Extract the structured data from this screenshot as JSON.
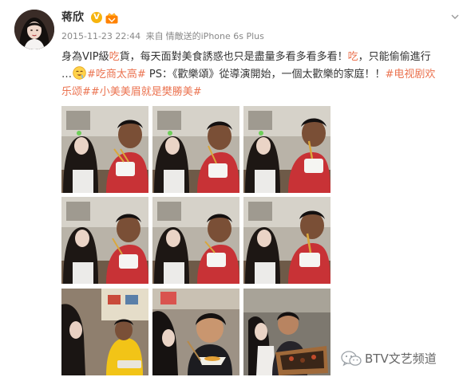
{
  "post": {
    "author": "蒋欣",
    "timestamp": "2015-11-23 22:44",
    "source_prefix": "来自",
    "source": "情敵送的iPhone 6s Plus",
    "line1": {
      "a": "身為VIP級",
      "b": "吃",
      "c": "貨，每天面對美食誘惑也只是盡量多看多看多看！",
      "d": "吃",
      "e": "，只能偷偷進行"
    },
    "line2": {
      "a": "…",
      "emoji": "drooling-face",
      "b": "#吃商太高#",
      "c": " PS：《歡樂頌》從導演開始，一個太歡樂的家庭！！",
      "d": "#电视剧欢"
    },
    "line3": {
      "a": "乐颂##小美美眉就是樊勝美#"
    }
  },
  "photos": [
    {
      "id": "photo-1",
      "scene": "eating-noodles"
    },
    {
      "id": "photo-2",
      "scene": "eating-noodles"
    },
    {
      "id": "photo-3",
      "scene": "eating-noodles"
    },
    {
      "id": "photo-4",
      "scene": "eating-noodles"
    },
    {
      "id": "photo-5",
      "scene": "eating-noodles"
    },
    {
      "id": "photo-6",
      "scene": "eating-noodles"
    },
    {
      "id": "photo-7",
      "scene": "restaurant"
    },
    {
      "id": "photo-8",
      "scene": "eating-skewer"
    },
    {
      "id": "photo-9",
      "scene": "snack-box"
    }
  ],
  "watermark": {
    "text": "BTV文艺频道",
    "icon": "wechat-icon"
  },
  "colors": {
    "accent": "#eb7350",
    "name": "#333333",
    "meta": "#888888",
    "verified": "#f6b40e"
  }
}
